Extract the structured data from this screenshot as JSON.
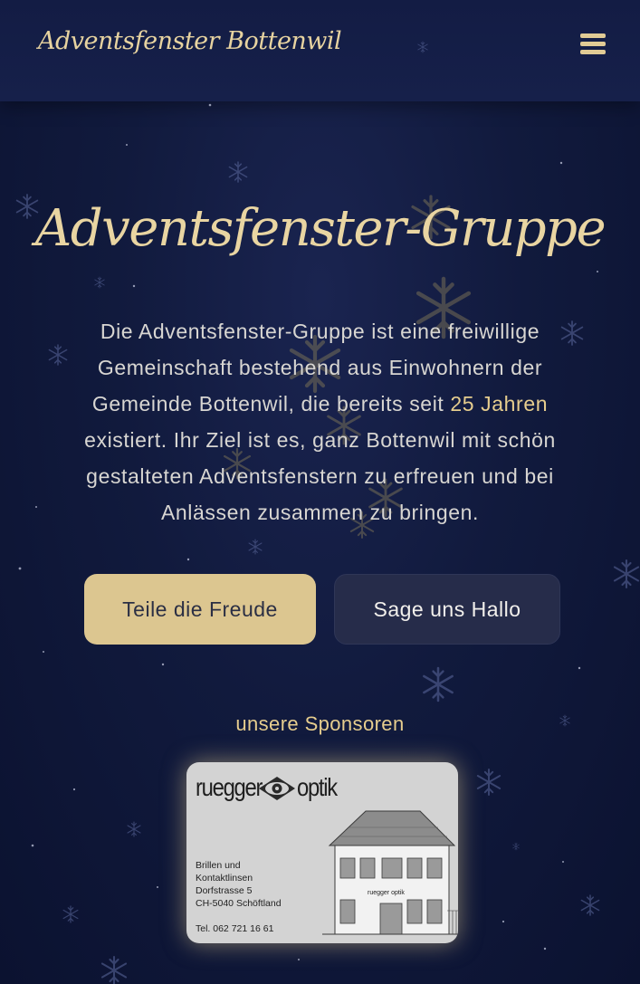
{
  "header": {
    "brand": "Adventsfenster Bottenwil",
    "menu_icon": "hamburger-menu-icon"
  },
  "hero": {
    "title": "Adventsfenster-Gruppe",
    "intro_before": "Die Adventsfenster-Gruppe ist eine freiwillige Gemeinschaft bestehend aus Einwohnern der Gemeinde Bottenwil, die bereits seit ",
    "intro_highlight": "25 Jahren",
    "intro_after": " existiert. Ihr Ziel ist es, ganz Bottenwil mit schön gestalteten Adventsfenstern zu erfreuen und bei Anlässen zusammen zu bringen."
  },
  "buttons": {
    "share": "Teile die Freude",
    "contact": "Sage uns Hallo"
  },
  "sponsors": {
    "heading": "unsere Sponsoren",
    "card": {
      "name_left": "ruegger",
      "name_right": "optik",
      "line1": "Brillen und",
      "line2": "Kontaktlinsen",
      "line3": "Dorfstrasse 5",
      "line4": "CH-5040 Schöftland",
      "phone": "Tel. 062 721 16 61",
      "sign": "ruegger optik"
    }
  },
  "colors": {
    "accent": "#e6cd8e",
    "button_primary": "#dcc690",
    "button_secondary": "#262c4a",
    "background": "#111a3d"
  },
  "decor": {
    "snowflake_icon": "snowflake-icon"
  }
}
